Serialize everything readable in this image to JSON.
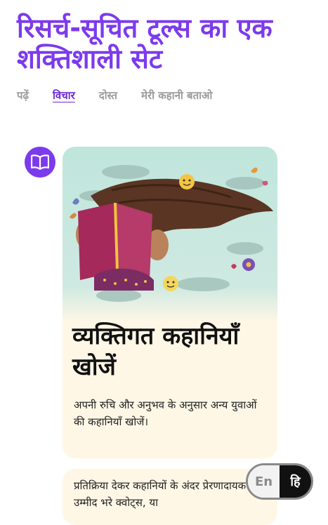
{
  "header": {
    "title": "रिसर्च-सूचित टूल्स का एक शक्तिशाली सेट"
  },
  "tabs": [
    {
      "label": "पढ़ें",
      "active": false
    },
    {
      "label": "विचार",
      "active": true
    },
    {
      "label": "दोस्त",
      "active": false
    },
    {
      "label": "मेरी कहानी बताओ",
      "active": false
    }
  ],
  "feature_card": {
    "icon": "book-icon",
    "title": "व्यक्तिगत कहानियाँ खोजें",
    "body": "अपनी रुचि और अनुभव के अनुसार अन्य युवाओं की कहानियाँ खोजें।"
  },
  "second_card": {
    "body": "प्रतिक्रिया देकर कहानियों के अंदर प्रेरणादायक भाग, उम्मीद भरे क्वोट्स, या"
  },
  "language_toggle": {
    "en_label": "En",
    "hi_label": "हि",
    "selected": "hi"
  },
  "colors": {
    "accent": "#7c3aed",
    "card_bg": "#fff7e6",
    "illustration_bg": "#bfe6dc"
  }
}
